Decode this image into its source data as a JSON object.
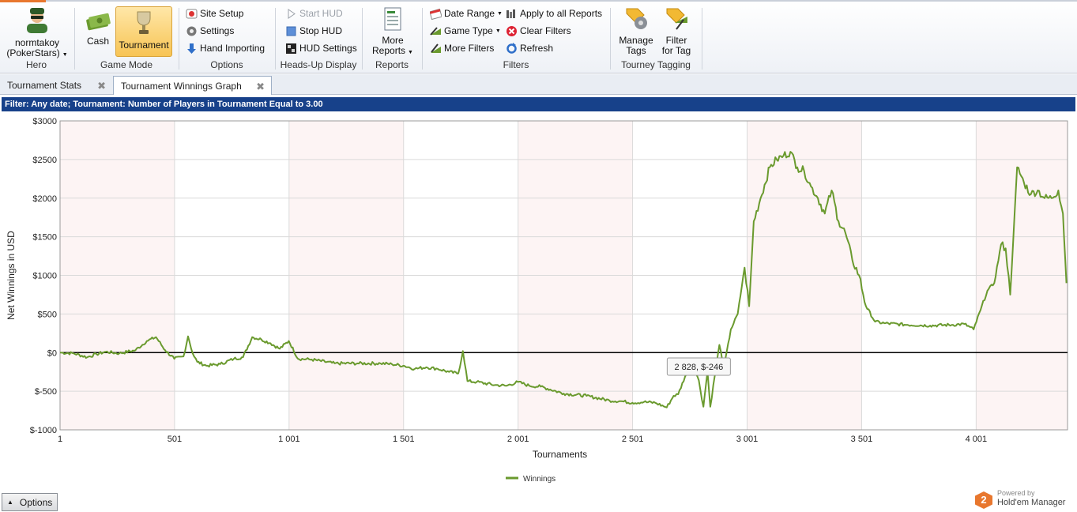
{
  "ribbon": {
    "hero": {
      "player": "normtakoy",
      "site": "(PokerStars)",
      "group_label": "Hero"
    },
    "game_mode": {
      "cash_label": "Cash",
      "tournament_label": "Tournament",
      "group_label": "Game Mode"
    },
    "options": {
      "site_setup": "Site Setup",
      "settings": "Settings",
      "hand_importing": "Hand Importing",
      "group_label": "Options"
    },
    "hud": {
      "start_hud": "Start HUD",
      "stop_hud": "Stop HUD",
      "hud_settings": "HUD Settings",
      "group_label": "Heads-Up Display"
    },
    "reports": {
      "more_line1": "More",
      "more_line2": "Reports",
      "group_label": "Reports"
    },
    "filters": {
      "date_range": "Date Range",
      "game_type": "Game Type",
      "more_filters": "More Filters",
      "apply_all": "Apply to all Reports",
      "clear_filters": "Clear Filters",
      "refresh": "Refresh",
      "group_label": "Filters"
    },
    "tagging": {
      "manage_line1": "Manage",
      "manage_line2": "Tags",
      "filter_line1": "Filter",
      "filter_line2": "for Tag",
      "group_label": "Tourney Tagging"
    }
  },
  "tabs": [
    {
      "label": "Tournament Stats",
      "active": false
    },
    {
      "label": "Tournament Winnings Graph",
      "active": true
    }
  ],
  "filter_text": "Filter: Any date; Tournament: Number of Players in Tournament Equal to 3.00",
  "chart_data": {
    "type": "line",
    "xlabel": "Tournaments",
    "ylabel": "Net Winnings in USD",
    "xlim": [
      1,
      4400
    ],
    "ylim": [
      -1000,
      3000
    ],
    "x_ticks": [
      1,
      501,
      1001,
      1501,
      2001,
      2501,
      3001,
      3501,
      4001
    ],
    "x_tick_labels": [
      "1",
      "501",
      "1 001",
      "1 501",
      "2 001",
      "2 501",
      "3 001",
      "3 501",
      "4 001"
    ],
    "y_ticks": [
      -1000,
      -500,
      0,
      500,
      1000,
      1500,
      2000,
      2500,
      3000
    ],
    "y_tick_labels": [
      "$-1000",
      "$-500",
      "$0",
      "$500",
      "$1000",
      "$1500",
      "$2000",
      "$2500",
      "$3000"
    ],
    "grid": true,
    "legend": "bottom-center",
    "series": [
      {
        "name": "Winnings",
        "color": "#6a9a2e",
        "x": [
          1,
          60,
          120,
          160,
          200,
          260,
          330,
          380,
          420,
          460,
          500,
          540,
          560,
          580,
          600,
          640,
          700,
          760,
          800,
          840,
          880,
          920,
          960,
          1000,
          1040,
          1100,
          1200,
          1300,
          1400,
          1450,
          1500,
          1550,
          1600,
          1650,
          1700,
          1740,
          1760,
          1780,
          1820,
          1900,
          1950,
          2000,
          2050,
          2100,
          2200,
          2300,
          2400,
          2450,
          2500,
          2550,
          2600,
          2650,
          2680,
          2700,
          2730,
          2760,
          2790,
          2810,
          2828,
          2840,
          2860,
          2880,
          2900,
          2930,
          2960,
          2990,
          3010,
          3030,
          3060,
          3100,
          3130,
          3160,
          3190,
          3220,
          3250,
          3280,
          3310,
          3340,
          3370,
          3400,
          3430,
          3460,
          3490,
          3520,
          3560,
          3600,
          3700,
          3800,
          3900,
          3950,
          3990,
          4020,
          4050,
          4080,
          4110,
          4130,
          4150,
          4180,
          4210,
          4240,
          4270,
          4300,
          4330,
          4360,
          4380,
          4395
        ],
        "y": [
          0,
          -10,
          -60,
          -20,
          10,
          -10,
          30,
          150,
          200,
          30,
          -80,
          -50,
          210,
          -10,
          -120,
          -170,
          -150,
          -80,
          -60,
          200,
          170,
          120,
          50,
          150,
          -80,
          -90,
          -140,
          -140,
          -140,
          -150,
          -170,
          -210,
          -190,
          -210,
          -250,
          -270,
          20,
          -370,
          -380,
          -420,
          -430,
          -380,
          -430,
          -440,
          -530,
          -560,
          -620,
          -630,
          -650,
          -640,
          -650,
          -710,
          -560,
          -540,
          -310,
          -150,
          -360,
          -700,
          -246,
          -700,
          -300,
          100,
          -200,
          300,
          500,
          1100,
          600,
          1700,
          2000,
          2400,
          2500,
          2550,
          2600,
          2400,
          2350,
          2150,
          2000,
          1800,
          2100,
          1700,
          1550,
          1200,
          1000,
          600,
          400,
          380,
          360,
          350,
          360,
          370,
          300,
          550,
          800,
          900,
          1400,
          1350,
          750,
          2400,
          2200,
          2050,
          2100,
          2000,
          2000,
          2100,
          1800,
          900
        ]
      }
    ],
    "tooltip": "2 828, $-246"
  },
  "bottom": {
    "options_label": "Options",
    "powered_by": "Powered by",
    "brand": "Hold'em Manager",
    "brand_badge": "2"
  }
}
